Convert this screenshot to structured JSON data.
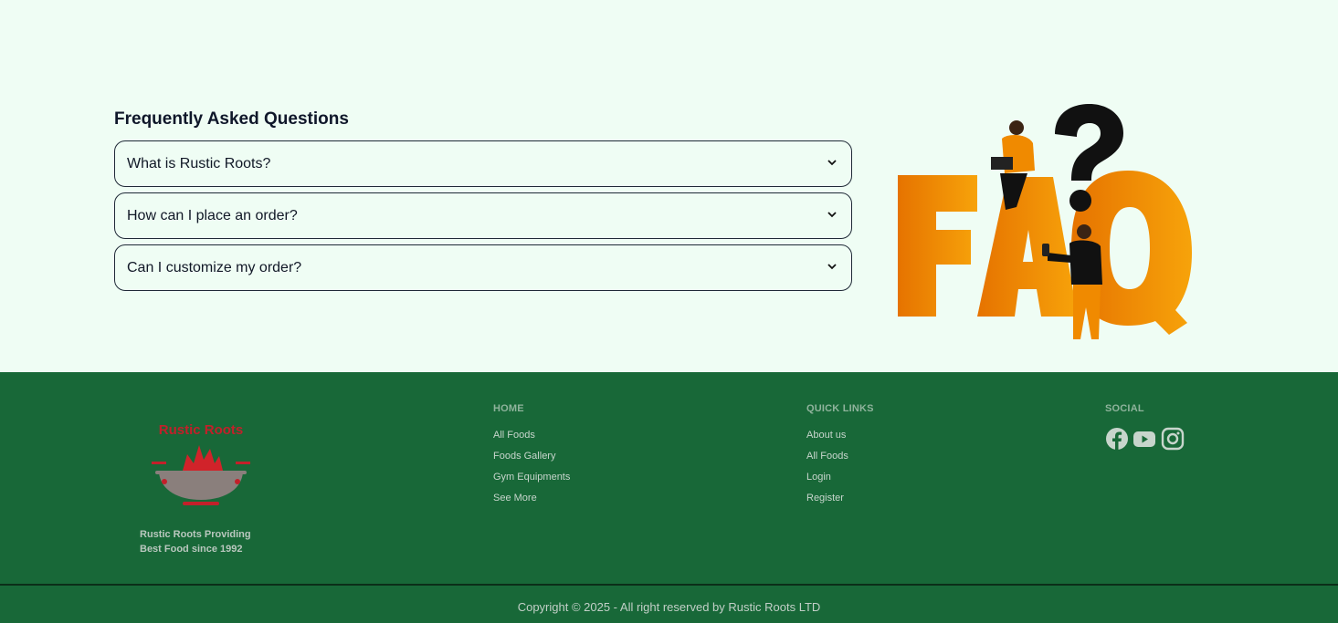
{
  "faq": {
    "title": "Frequently Asked Questions",
    "items": [
      {
        "question": "What is Rustic Roots?"
      },
      {
        "question": "How can I place an order?"
      },
      {
        "question": "Can I customize my order?"
      }
    ],
    "art_text": "FAQ"
  },
  "footer": {
    "logo_text": "Rustic Roots",
    "tagline": "Rustic Roots Providing\nBest Food since 1992",
    "home": {
      "title": "HOME",
      "links": [
        "All Foods",
        "Foods Gallery",
        "Gym Equipments",
        "See More"
      ]
    },
    "quick_links": {
      "title": "QUICK LINKS",
      "links": [
        "About us",
        "All Foods",
        "Login",
        "Register"
      ]
    },
    "social": {
      "title": "SOCIAL",
      "icons": [
        "facebook-icon",
        "youtube-icon",
        "instagram-icon"
      ]
    },
    "copyright": "Copyright © 2025 - All right reserved by Rustic Roots LTD"
  },
  "colors": {
    "page_bg": "#effdf4",
    "footer_bg": "#186838",
    "accent_orange": "#f08a00",
    "logo_red": "#c2202a"
  }
}
